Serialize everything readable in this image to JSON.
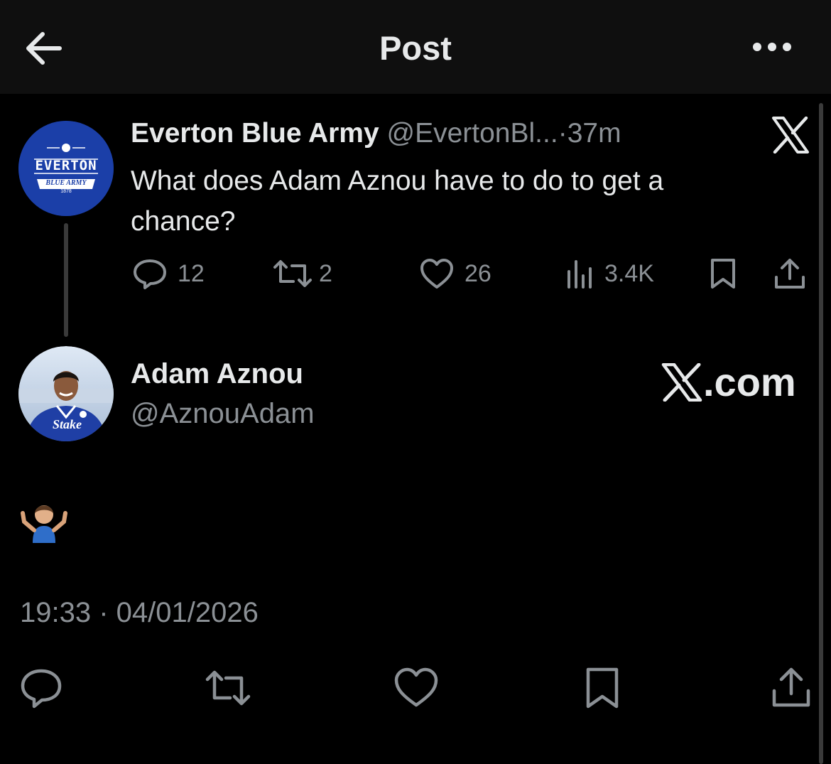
{
  "header": {
    "title": "Post",
    "back_icon": "arrow-left-icon",
    "more_icon": "more-horizontal-icon"
  },
  "quoted_tweet": {
    "author_name": "Everton Blue Army",
    "handle": "@EvertonBl...",
    "separator": "·",
    "time": "37m",
    "text": "What does Adam Aznou have to do to get a chance?",
    "avatar": {
      "line1": "EVERTON",
      "line2": "BLUE ARMY",
      "line3": "1878"
    },
    "stats": {
      "replies": "12",
      "reposts": "2",
      "likes": "26",
      "views": "3.4K"
    }
  },
  "reply": {
    "author_name": "Adam Aznou",
    "handle": "@AznouAdam",
    "avatar_text": "Stake",
    "brand_logo_text": ".com",
    "body_emoji": "person-shrugging-emoji",
    "timestamp": "19:33 · 04/01/2026"
  },
  "colors": {
    "background": "#000000",
    "header": "#0f0f0f",
    "primary_text": "#e7e9ea",
    "muted_text": "#8b9095",
    "everton_blue": "#1b3fa8"
  }
}
